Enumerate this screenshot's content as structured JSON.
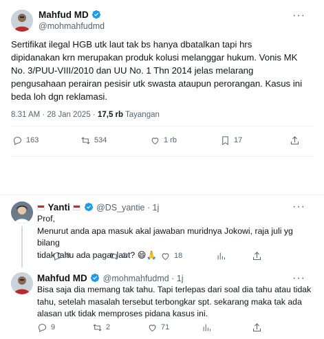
{
  "main_tweet": {
    "name": "Mahfud MD",
    "handle": "@mohmahfudmd",
    "text_lines": [
      "Sertifikat ilegal HGB utk laut tak bs hanya dbatalkan tapi hrs",
      "dipidanakan krn merupakan produk kolusi melanggar hukum. Vonis MK",
      "No. 3/PUU-VIII/2010 dan UU No. 1 Thn 2014 jelas melarang",
      "pengusahaan perairan pesisir utk swasta ataupun perorangan. Kasus ini",
      "beda loh dgn reklamasi."
    ],
    "time": "8.31 AM · 28 Jan 2025 · ",
    "views": "17,5 rb",
    "views_label": " Tayangan",
    "replies": "163",
    "reposts": "534",
    "likes": "1 rb",
    "bookmarks": "17"
  },
  "reply1": {
    "name": "Yanti",
    "handle": "@DS_yantie · 1j",
    "text_lines": [
      "Prof,",
      "Menurut anda apa masuk akal jawaban muridnya Jokowi, raja juli yg bilang",
      "tidak tahu ada pagar laut? 😄🙏"
    ],
    "replies": "8",
    "reposts": "3",
    "likes": "18"
  },
  "reply2": {
    "name": "Mahfud MD",
    "handle": "@mohmahfudmd · 1j",
    "text_lines": [
      "Bisa saja dia memang tak tahu. Tapi terlepas dari soal dia tahu atau tidak",
      "tahu, setelah masalah tersebut terbongkar spt. sekarang maka tak ada",
      "alasan utk tidak memproses pidana kasus ini."
    ],
    "replies": "9",
    "reposts": "2",
    "likes": "71"
  },
  "icons": {
    "more": "more-icon",
    "verified": "verified-badge-icon",
    "reply": "reply-icon",
    "repost": "repost-icon",
    "like": "like-icon",
    "views": "views-icon",
    "bookmark": "bookmark-icon",
    "share": "share-icon"
  },
  "colors": {
    "verified": "#1d9bf0",
    "muted": "#536471",
    "divider": "#eff3f4"
  }
}
